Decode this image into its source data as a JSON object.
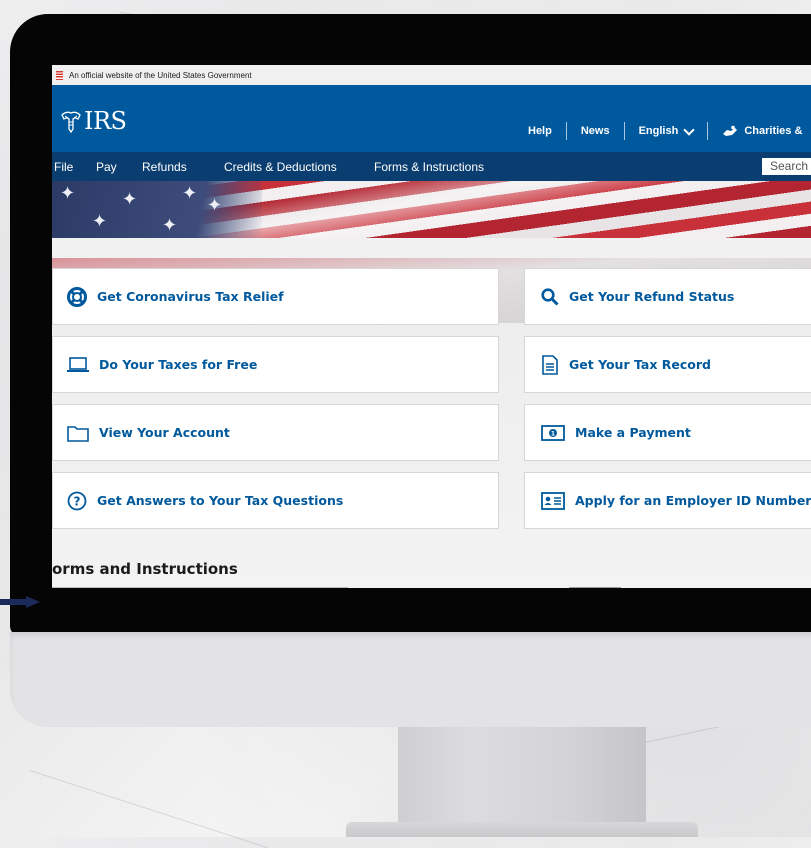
{
  "gov_banner": {
    "text": "An official website of the United States Government"
  },
  "header": {
    "logo_text": "IRS",
    "utility_nav": [
      {
        "label": "Help"
      },
      {
        "label": "News"
      },
      {
        "label": "English"
      },
      {
        "label": "Charities &"
      }
    ]
  },
  "main_nav": {
    "items": [
      {
        "label": "File"
      },
      {
        "label": "Pay"
      },
      {
        "label": "Refunds"
      },
      {
        "label": "Credits & Deductions"
      },
      {
        "label": "Forms & Instructions"
      }
    ],
    "search_placeholder": "Search"
  },
  "tiles": {
    "left": [
      {
        "label": "Get Coronavirus Tax Relief",
        "icon": "lifebuoy-icon"
      },
      {
        "label": "Do Your Taxes for Free",
        "icon": "laptop-icon"
      },
      {
        "label": "View Your Account",
        "icon": "folder-icon"
      },
      {
        "label": "Get Answers to Your Tax Questions",
        "icon": "question-circle-icon"
      }
    ],
    "right": [
      {
        "label": "Get Your Refund Status",
        "icon": "search-icon"
      },
      {
        "label": "Get Your Tax Record",
        "icon": "document-icon"
      },
      {
        "label": "Make a Payment",
        "icon": "money-icon"
      },
      {
        "label": "Apply for an Employer ID Number (",
        "icon": "id-card-icon"
      }
    ]
  },
  "section": {
    "title": "orms and Instructions"
  },
  "colors": {
    "irs_blue": "#00599c",
    "nav_navy": "#0b3e70",
    "link_blue": "#00599c"
  }
}
